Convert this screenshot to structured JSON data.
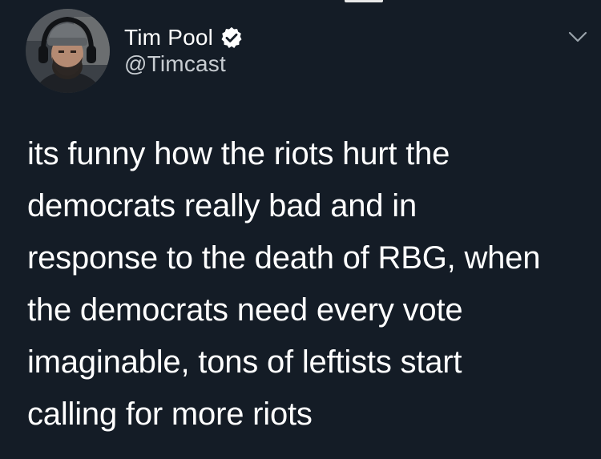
{
  "tweet": {
    "author": {
      "display_name": "Tim Pool",
      "handle": "@Timcast",
      "verified": true,
      "avatar_icon": "user-avatar"
    },
    "text": "its funny how the riots hurt the\ndemocrats really bad and in\nresponse to the death of RBG, when\nthe democrats need every vote\nimaginable, tons of leftists start\ncalling for more riots",
    "menu_icon": "chevron-down-icon"
  },
  "colors": {
    "background": "#141c26",
    "text": "#ffffff",
    "handle": "#c7ccd1",
    "verified_badge": "#ffffff"
  }
}
